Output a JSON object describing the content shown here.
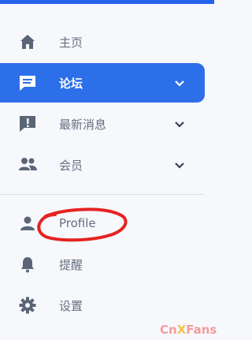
{
  "menu": {
    "items": [
      {
        "label": "主页",
        "icon": "home-icon",
        "has_chevron": false,
        "active": false
      },
      {
        "label": "论坛",
        "icon": "forum-icon",
        "has_chevron": true,
        "active": true
      },
      {
        "label": "最新消息",
        "icon": "announcement-icon",
        "has_chevron": true,
        "active": false
      },
      {
        "label": "会员",
        "icon": "members-icon",
        "has_chevron": true,
        "active": false
      }
    ],
    "bottom_items": [
      {
        "label": "Profile",
        "icon": "person-icon"
      },
      {
        "label": "提醒",
        "icon": "bell-icon"
      },
      {
        "label": "设置",
        "icon": "gear-icon"
      }
    ]
  },
  "watermark": {
    "part1": "Cn",
    "part2": "X",
    "part3": "Fans"
  },
  "colors": {
    "accent": "#2d6fe8",
    "icon": "#5b6577",
    "label": "#666e7f",
    "scribble": "#e52222"
  }
}
